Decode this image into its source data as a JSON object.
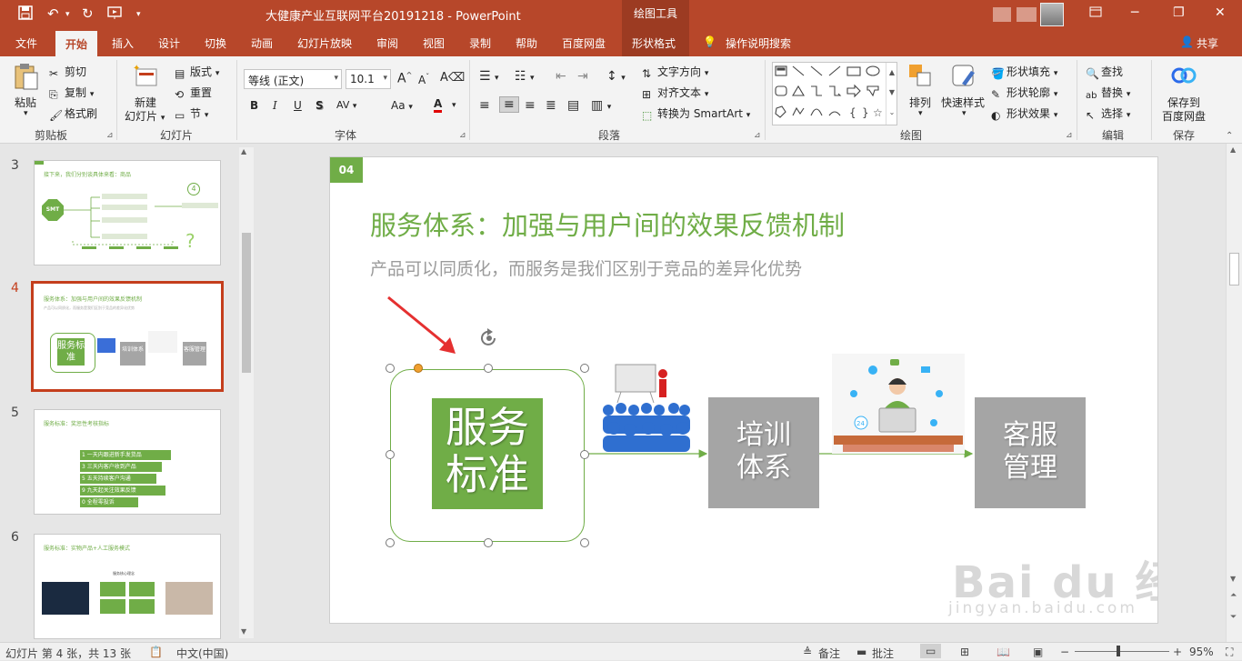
{
  "titlebar": {
    "doc_title": "大健康产业互联网平台20191218  -  PowerPoint",
    "context_title": "绘图工具",
    "save_icon": "save-icon",
    "minimize": "─",
    "restore": "❐",
    "close": "✕"
  },
  "tabs": [
    "文件",
    "开始",
    "插入",
    "设计",
    "切换",
    "动画",
    "幻灯片放映",
    "审阅",
    "视图",
    "录制",
    "帮助",
    "百度网盘",
    "形状格式"
  ],
  "active_tab": "开始",
  "tell_me": "操作说明搜索",
  "share": "共享",
  "ribbon": {
    "clipboard": {
      "label": "剪贴板",
      "paste": "粘贴",
      "cut": "剪切",
      "copy": "复制",
      "format_painter": "格式刷"
    },
    "slides": {
      "label": "幻灯片",
      "new_slide_line1": "新建",
      "new_slide_line2": "幻灯片",
      "layout": "版式",
      "reset": "重置",
      "section": "节"
    },
    "font": {
      "label": "字体",
      "font_name": "等线 (正文)",
      "font_size": "10.1",
      "bold": "B",
      "italic": "I",
      "underline": "U",
      "shadow": "S",
      "spacing": "AV",
      "case": "Aa",
      "color": "A"
    },
    "paragraph": {
      "label": "段落",
      "text_direction": "文字方向",
      "align_text": "对齐文本",
      "smartart": "转换为 SmartArt"
    },
    "drawing": {
      "label": "绘图",
      "arrange": "排列",
      "quick_styles": "快速样式",
      "shape_fill": "形状填充",
      "shape_outline": "形状轮廓",
      "shape_effects": "形状效果"
    },
    "editing": {
      "label": "编辑",
      "find": "查找",
      "replace": "替换",
      "select": "选择"
    },
    "save": {
      "label": "保存",
      "save_to_line1": "保存到",
      "save_to_line2": "百度网盘"
    }
  },
  "thumbnails": [
    {
      "num": "3",
      "title": "接下来，我们分别谈具体来看：商品",
      "badge": "SMT",
      "number_icon": "4"
    },
    {
      "num": "4",
      "title": "服务体系：加强与用户间的效果反馈机制",
      "sub": "产品可以同质化，而服务是我们区别于竞品的差异化优势",
      "box1": "服务标准",
      "box2": "培训体系",
      "box3": "客服管理"
    },
    {
      "num": "5",
      "title": "服务标准：奖惩性考核指标",
      "list": [
        "1  一天内跟进新手发货品",
        "3  三天内客户收到产品",
        "5  五天持续客户沟通",
        "9  九天起关注效果反馈",
        "0  全程零投诉"
      ]
    },
    {
      "num": "6",
      "title": "服务标准：实物产品+人工服务模式",
      "sub": "服务核心理念"
    }
  ],
  "slide": {
    "badge": "04",
    "title": "服务体系：加强与用户间的效果反馈机制",
    "subtitle": "产品可以同质化，而服务是我们区别于竞品的差异化优势",
    "box1_line1": "服务",
    "box1_line2": "标准",
    "box2_line1": "培训",
    "box2_line2": "体系",
    "box3_line1": "客服",
    "box3_line2": "管理",
    "watermark": "Bai du 经验",
    "watermark_url": "jingyan.baidu.com",
    "badge_24": "24"
  },
  "statusbar": {
    "slide_info": "幻灯片 第 4 张，共 13 张",
    "language": "中文(中国)",
    "notes": "备注",
    "comments": "批注",
    "zoom": "95%"
  },
  "colors": {
    "accent": "#b7472a",
    "green": "#70ad47",
    "gray_box": "#a5a5a5"
  }
}
